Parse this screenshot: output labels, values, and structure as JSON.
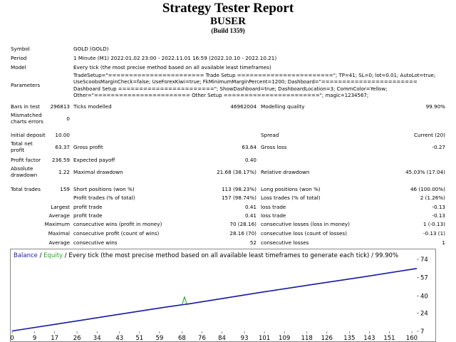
{
  "header": {
    "title": "Strategy Tester Report",
    "subtitle": "BUSER",
    "build": "(Build 1359)"
  },
  "symbol": {
    "label": "Symbol",
    "value": "GOLD (GOLD)"
  },
  "period": {
    "label": "Period",
    "value": "1 Minute (M1) 2022.01.02 23:00 - 2022.11.01 16:59 (2022.10.10 - 2022.10.21)"
  },
  "model": {
    "label": "Model",
    "value": "Every tick (the most precise method based on all available least timeframes)"
  },
  "parameters": {
    "label": "Parameters",
    "value": "TradeSetup=\"======================= Trade Setup =======================\"; TP=41; SL=0; lot=0.01; AutoLot=true; UseScoobsMarginCheck=false; UseForexKiwi=true; FkMinimumMarginPercent=1200; Dashboard=\"======================= Dashboard Setup =======================\"; ShowDashboard=true; DashboardLocation=3; CommColor=Yellow; Other=\"======================= Other Setup =======================\"; magic=1234567;"
  },
  "stats1": {
    "bars_label": "Bars in test",
    "bars_value": "296813",
    "ticks_label": "Ticks modelled",
    "ticks_value": "46962004",
    "quality_label": "Modelling quality",
    "quality_value": "99.90%",
    "mismatch_label": "Mismatched charts errors",
    "mismatch_value": "0"
  },
  "stats2": {
    "deposit_label": "Initial deposit",
    "deposit_value": "10.00",
    "spread_label": "Spread",
    "spread_value": "Current (20)",
    "netprofit_label": "Total net profit",
    "netprofit_value": "63.37",
    "grossprofit_label": "Gross profit",
    "grossprofit_value": "63.64",
    "grossloss_label": "Gross loss",
    "grossloss_value": "-0.27",
    "pf_label": "Profit factor",
    "pf_value": "236.59",
    "ep_label": "Expected payoff",
    "ep_value": "0.40",
    "absdd_label": "Absolute drawdown",
    "absdd_value": "1.22",
    "maxdd_label": "Maximal drawdown",
    "maxdd_value": "21.68 (38.17%)",
    "reldd_label": "Relative drawdown",
    "reldd_value": "45.03% (17.04)"
  },
  "trades": {
    "total_label": "Total trades",
    "total_value": "159",
    "short_label": "Short positions (won %)",
    "short_value": "113 (98.23%)",
    "long_label": "Long positions (won %)",
    "long_value": "46 (100.00%)",
    "profit_trades_label": "Profit trades (% of total)",
    "profit_trades_value": "157 (98.74%)",
    "loss_trades_label": "Loss trades (% of total)",
    "loss_trades_value": "2 (1.26%)",
    "largest_label": "Largest",
    "largest_profit_label": "profit trade",
    "largest_profit_value": "0.41",
    "largest_loss_label": "loss trade",
    "largest_loss_value": "-0.13",
    "average_label": "Average",
    "average_profit_label": "profit trade",
    "average_profit_value": "0.41",
    "average_loss_label": "loss trade",
    "average_loss_value": "-0.13",
    "maximum_label": "Maximum",
    "max_wins_label": "consecutive wins (profit in money)",
    "max_wins_value": "70 (28.16)",
    "max_losses_label": "consecutive losses (loss in money)",
    "max_losses_value": "1 (-0.13)",
    "maximal_label": "Maximal",
    "mx_profit_label": "consecutive profit (count of wins)",
    "mx_profit_value": "28.16 (70)",
    "mx_loss_label": "consecutive loss (count of losses)",
    "mx_loss_value": "-0.13 (1)",
    "avg2_label": "Average",
    "avg_wins_label": "consecutive wins",
    "avg_wins_value": "52",
    "avg_losses_label": "consecutive losses",
    "avg_losses_value": "1"
  },
  "chart_legend": {
    "balance": "Balance",
    "sep1": " / ",
    "equity": "Equity",
    "rest": " / Every tick (the most precise method based on all available least timeframes to generate each tick) / 99.90%"
  },
  "colors": {
    "balance": "#1a1aa6",
    "equity": "#22aa22"
  },
  "chart_data": {
    "type": "line",
    "xlim": [
      0,
      162
    ],
    "ylim": [
      7,
      74
    ],
    "x_ticks": [
      "0",
      "9",
      "17",
      "26",
      "34",
      "43",
      "51",
      "59",
      "68",
      "76",
      "84",
      "93",
      "101",
      "109",
      "118",
      "126",
      "135",
      "143",
      "151",
      "160"
    ],
    "y_ticks": [
      "7",
      "24",
      "40",
      "57",
      "74"
    ],
    "series": [
      {
        "name": "Balance",
        "values": [
          [
            0,
            7.3
          ],
          [
            20,
            14.5
          ],
          [
            40,
            21.8
          ],
          [
            60,
            29.0
          ],
          [
            72,
            33.0
          ],
          [
            80,
            36.0
          ],
          [
            100,
            43.4
          ],
          [
            120,
            50.5
          ],
          [
            140,
            57.5
          ],
          [
            160,
            64.8
          ],
          [
            162,
            65.5
          ]
        ]
      },
      {
        "name": "Equity",
        "values": [
          [
            0,
            7.3
          ],
          [
            20,
            14.5
          ],
          [
            40,
            21.8
          ],
          [
            60,
            29.0
          ],
          [
            68,
            31.6
          ],
          [
            69,
            39.0
          ],
          [
            70,
            32.0
          ],
          [
            72,
            33.0
          ],
          [
            80,
            36.0
          ],
          [
            100,
            43.4
          ],
          [
            120,
            50.5
          ],
          [
            140,
            57.5
          ],
          [
            160,
            64.8
          ],
          [
            162,
            65.5
          ]
        ]
      }
    ]
  }
}
